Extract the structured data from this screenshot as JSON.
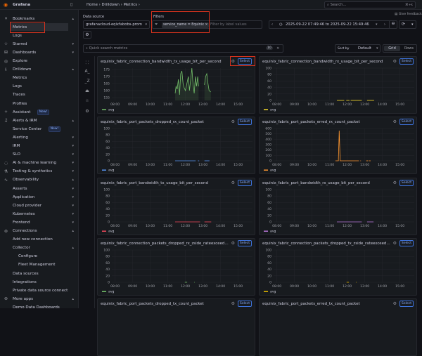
{
  "app": {
    "name": "Grafana"
  },
  "breadcrumb": [
    "Home",
    "Drilldown",
    "Metrics"
  ],
  "search": {
    "placeholder": "Search...",
    "shortcut": "⌘+k"
  },
  "sidebar": {
    "items": [
      {
        "label": "Bookmarks",
        "icon": "bookmark-icon",
        "chev": "▴"
      },
      {
        "label": "Metrics",
        "level": 1,
        "active": true
      },
      {
        "label": "Logs",
        "level": 1
      },
      {
        "label": "Starred",
        "icon": "star-icon",
        "chev": "▾"
      },
      {
        "label": "Dashboards",
        "icon": "grid-icon",
        "chev": "▾"
      },
      {
        "label": "Explore",
        "icon": "compass-icon"
      },
      {
        "label": "Drilldown",
        "icon": "drilldown-icon",
        "chev": "▴"
      },
      {
        "label": "Metrics",
        "level": 1
      },
      {
        "label": "Logs",
        "level": 1
      },
      {
        "label": "Traces",
        "level": 1
      },
      {
        "label": "Profiles",
        "level": 1
      },
      {
        "label": "Assistant",
        "icon": "sparkle-icon",
        "badge": "New!"
      },
      {
        "label": "Alerts & IRM",
        "icon": "bell-icon",
        "chev": "▴"
      },
      {
        "label": "Service Center",
        "level": 1,
        "badge": "New!"
      },
      {
        "label": "Alerting",
        "level": 1,
        "chev": "▾"
      },
      {
        "label": "IRM",
        "level": 1,
        "chev": "▾"
      },
      {
        "label": "SLO",
        "level": 1,
        "chev": "▾"
      },
      {
        "label": "AI & machine learning",
        "icon": "brain-icon",
        "chev": "▾"
      },
      {
        "label": "Testing & synthetics",
        "icon": "testing-icon",
        "chev": "▾"
      },
      {
        "label": "Observability",
        "icon": "pulse-icon",
        "chev": "▴"
      },
      {
        "label": "Asserts",
        "level": 1,
        "chev": "▾"
      },
      {
        "label": "Application",
        "level": 1,
        "chev": "▾"
      },
      {
        "label": "Cloud provider",
        "level": 1,
        "chev": "▾"
      },
      {
        "label": "Kubernetes",
        "level": 1,
        "chev": "▾"
      },
      {
        "label": "Frontend",
        "level": 1,
        "chev": "▾"
      },
      {
        "label": "Connections",
        "icon": "plug-icon",
        "chev": "▴"
      },
      {
        "label": "Add new connection",
        "level": 1
      },
      {
        "label": "Collector",
        "level": 1,
        "chev": "▴"
      },
      {
        "label": "Configure",
        "level": 2
      },
      {
        "label": "Fleet Management",
        "level": 2
      },
      {
        "label": "Data sources",
        "level": 1
      },
      {
        "label": "Integrations",
        "level": 1
      },
      {
        "label": "Private data source connect",
        "level": 1
      },
      {
        "label": "More apps",
        "icon": "apps-icon",
        "chev": "▴"
      },
      {
        "label": "Demo Data Dashboards",
        "level": 1
      }
    ]
  },
  "controls": {
    "datasource_label": "Data source",
    "datasource_value": "grafanacloud-eqixfabobs-prom",
    "filters_label": "Filters",
    "filter_chip": "service_name = Equinix",
    "filter_placeholder": "Filter by label values",
    "time_range": "2025-09-22 07:49:46 to 2025-09-22 15:49:46",
    "feedback": "Give feedback",
    "quick_search_placeholder": "Quick search metrics",
    "metric_count": "10",
    "sort_label": "Sort by",
    "sort_value": "Default",
    "view_grid": "Grid",
    "view_rows": "Rows"
  },
  "panel_common": {
    "select_label": "Select",
    "legend": "avg",
    "x_ticks": [
      "08:00",
      "09:00",
      "10:00",
      "11:00",
      "12:00",
      "13:00",
      "14:00",
      "15:00"
    ]
  },
  "panels": [
    {
      "title": "equinix_fabric_connection_bandwidth_tx_usage_bit_per_second",
      "color": "#73bf69",
      "y_ticks": [
        155,
        160,
        165,
        170,
        175
      ],
      "ylim": [
        153,
        176
      ],
      "fill": true,
      "segments": [
        [
          [
            "11:25",
            158
          ],
          [
            "11:28",
            163
          ],
          [
            "11:32",
            161
          ],
          [
            "11:36",
            168
          ],
          [
            "11:40",
            157
          ],
          [
            "11:44",
            172
          ],
          [
            "11:48",
            174
          ],
          [
            "11:52",
            165
          ],
          [
            "11:56",
            162
          ],
          [
            "12:00",
            160
          ],
          [
            "12:05",
            165
          ],
          [
            "12:10",
            170
          ],
          [
            "12:14",
            160
          ],
          [
            "12:18",
            168
          ],
          [
            "12:22",
            176
          ],
          [
            "12:26",
            165
          ],
          [
            "12:30",
            158
          ],
          [
            "12:34",
            170
          ],
          [
            "12:38",
            163
          ],
          [
            "12:42",
            170
          ],
          [
            "12:45",
            163
          ]
        ],
        [
          [
            "13:05",
            164
          ],
          [
            "13:09",
            170
          ],
          [
            "13:13",
            172
          ],
          [
            "13:17",
            165
          ],
          [
            "13:21",
            160
          ],
          [
            "13:27",
            159
          ]
        ]
      ]
    },
    {
      "title": "equinix_fabric_connection_bandwidth_rx_usage_bit_per_second",
      "color": "#fade2a",
      "y_ticks": [
        0,
        20,
        40,
        60,
        80,
        100
      ],
      "ylim": [
        0,
        100
      ],
      "segments": [
        [
          [
            "11:25",
            0
          ],
          [
            "11:50",
            0
          ]
        ],
        [
          [
            "11:57",
            0
          ],
          [
            "12:08",
            0
          ]
        ],
        [
          [
            "12:12",
            0
          ],
          [
            "12:50",
            0
          ]
        ],
        [
          [
            "13:08",
            0
          ],
          [
            "13:32",
            0
          ]
        ]
      ]
    },
    {
      "title": "equinix_fabric_port_packets_dropped_rx_count_packet",
      "color": "#5794f2",
      "y_ticks": [
        0,
        20,
        40,
        60,
        80,
        100
      ],
      "ylim": [
        0,
        100
      ],
      "segments": [
        [
          [
            "11:25",
            0
          ],
          [
            "12:35",
            0
          ]
        ],
        [
          [
            "12:43",
            0
          ],
          [
            "12:47",
            0
          ]
        ],
        [
          [
            "13:05",
            0
          ],
          [
            "13:22",
            0
          ]
        ]
      ]
    },
    {
      "title": "equinix_fabric_port_packets_erred_rx_count_packet",
      "color": "#ff9830",
      "y_ticks": [
        0,
        100,
        200,
        300,
        400,
        500,
        600
      ],
      "ylim": [
        0,
        600
      ],
      "segments": [
        [
          [
            "11:20",
            0
          ],
          [
            "11:30",
            0
          ],
          [
            "11:33",
            560
          ],
          [
            "11:36",
            0
          ],
          [
            "12:40",
            0
          ]
        ],
        [
          [
            "12:45",
            0
          ],
          [
            "12:47",
            0
          ]
        ],
        [
          [
            "13:05",
            0
          ],
          [
            "13:12",
            0
          ]
        ],
        [
          [
            "13:15",
            0
          ],
          [
            "13:20",
            0
          ]
        ]
      ]
    },
    {
      "title": "equinix_fabric_port_bandwidth_tx_usage_bit_per_second",
      "color": "#f2495c",
      "y_ticks": [
        0,
        20,
        40,
        60,
        80,
        100
      ],
      "ylim": [
        0,
        100
      ],
      "segments": [
        [
          [
            "11:25",
            0
          ],
          [
            "12:50",
            0
          ]
        ],
        [
          [
            "13:05",
            0
          ],
          [
            "13:28",
            0
          ]
        ]
      ]
    },
    {
      "title": "equinix_fabric_port_bandwidth_rx_usage_bit_per_second",
      "color": "#b877d9",
      "y_ticks": [
        0,
        20,
        40,
        60,
        80,
        100
      ],
      "ylim": [
        0,
        100
      ],
      "segments": [
        [
          [
            "11:25",
            0
          ],
          [
            "12:50",
            0
          ]
        ],
        [
          [
            "13:08",
            0
          ],
          [
            "13:30",
            0
          ]
        ]
      ]
    },
    {
      "title": "equinix_fabric_connection_packets_dropped_rx_zside_rateexceeded_...",
      "color": "#73bf69",
      "y_ticks": [
        0,
        20,
        40,
        60,
        80,
        100
      ],
      "ylim": [
        0,
        100
      ],
      "segments": [
        [
          [
            "11:58",
            0
          ],
          [
            "12:06",
            0
          ]
        ],
        [
          [
            "12:30",
            0
          ],
          [
            "12:32",
            0
          ]
        ]
      ]
    },
    {
      "title": "equinix_fabric_connection_packets_dropped_tx_zside_rateexceeded_...",
      "color": "#e0b400",
      "y_ticks": [
        0,
        20,
        40,
        60,
        80,
        100
      ],
      "ylim": [
        0,
        100
      ],
      "segments": [
        [
          [
            "11:58",
            0
          ],
          [
            "12:06",
            0
          ]
        ],
        [
          [
            "12:30",
            0
          ],
          [
            "12:32",
            0
          ]
        ]
      ]
    },
    {
      "title": "equinix_fabric_port_packets_dropped_tx_count_packet",
      "color": "#5794f2",
      "y_ticks": [],
      "ylim": [
        0,
        100
      ],
      "segments": []
    },
    {
      "title": "equinix_fabric_port_packets_erred_tx_count_packet",
      "color": "#ff9830",
      "y_ticks": [],
      "ylim": [
        0,
        100
      ],
      "segments": []
    }
  ]
}
